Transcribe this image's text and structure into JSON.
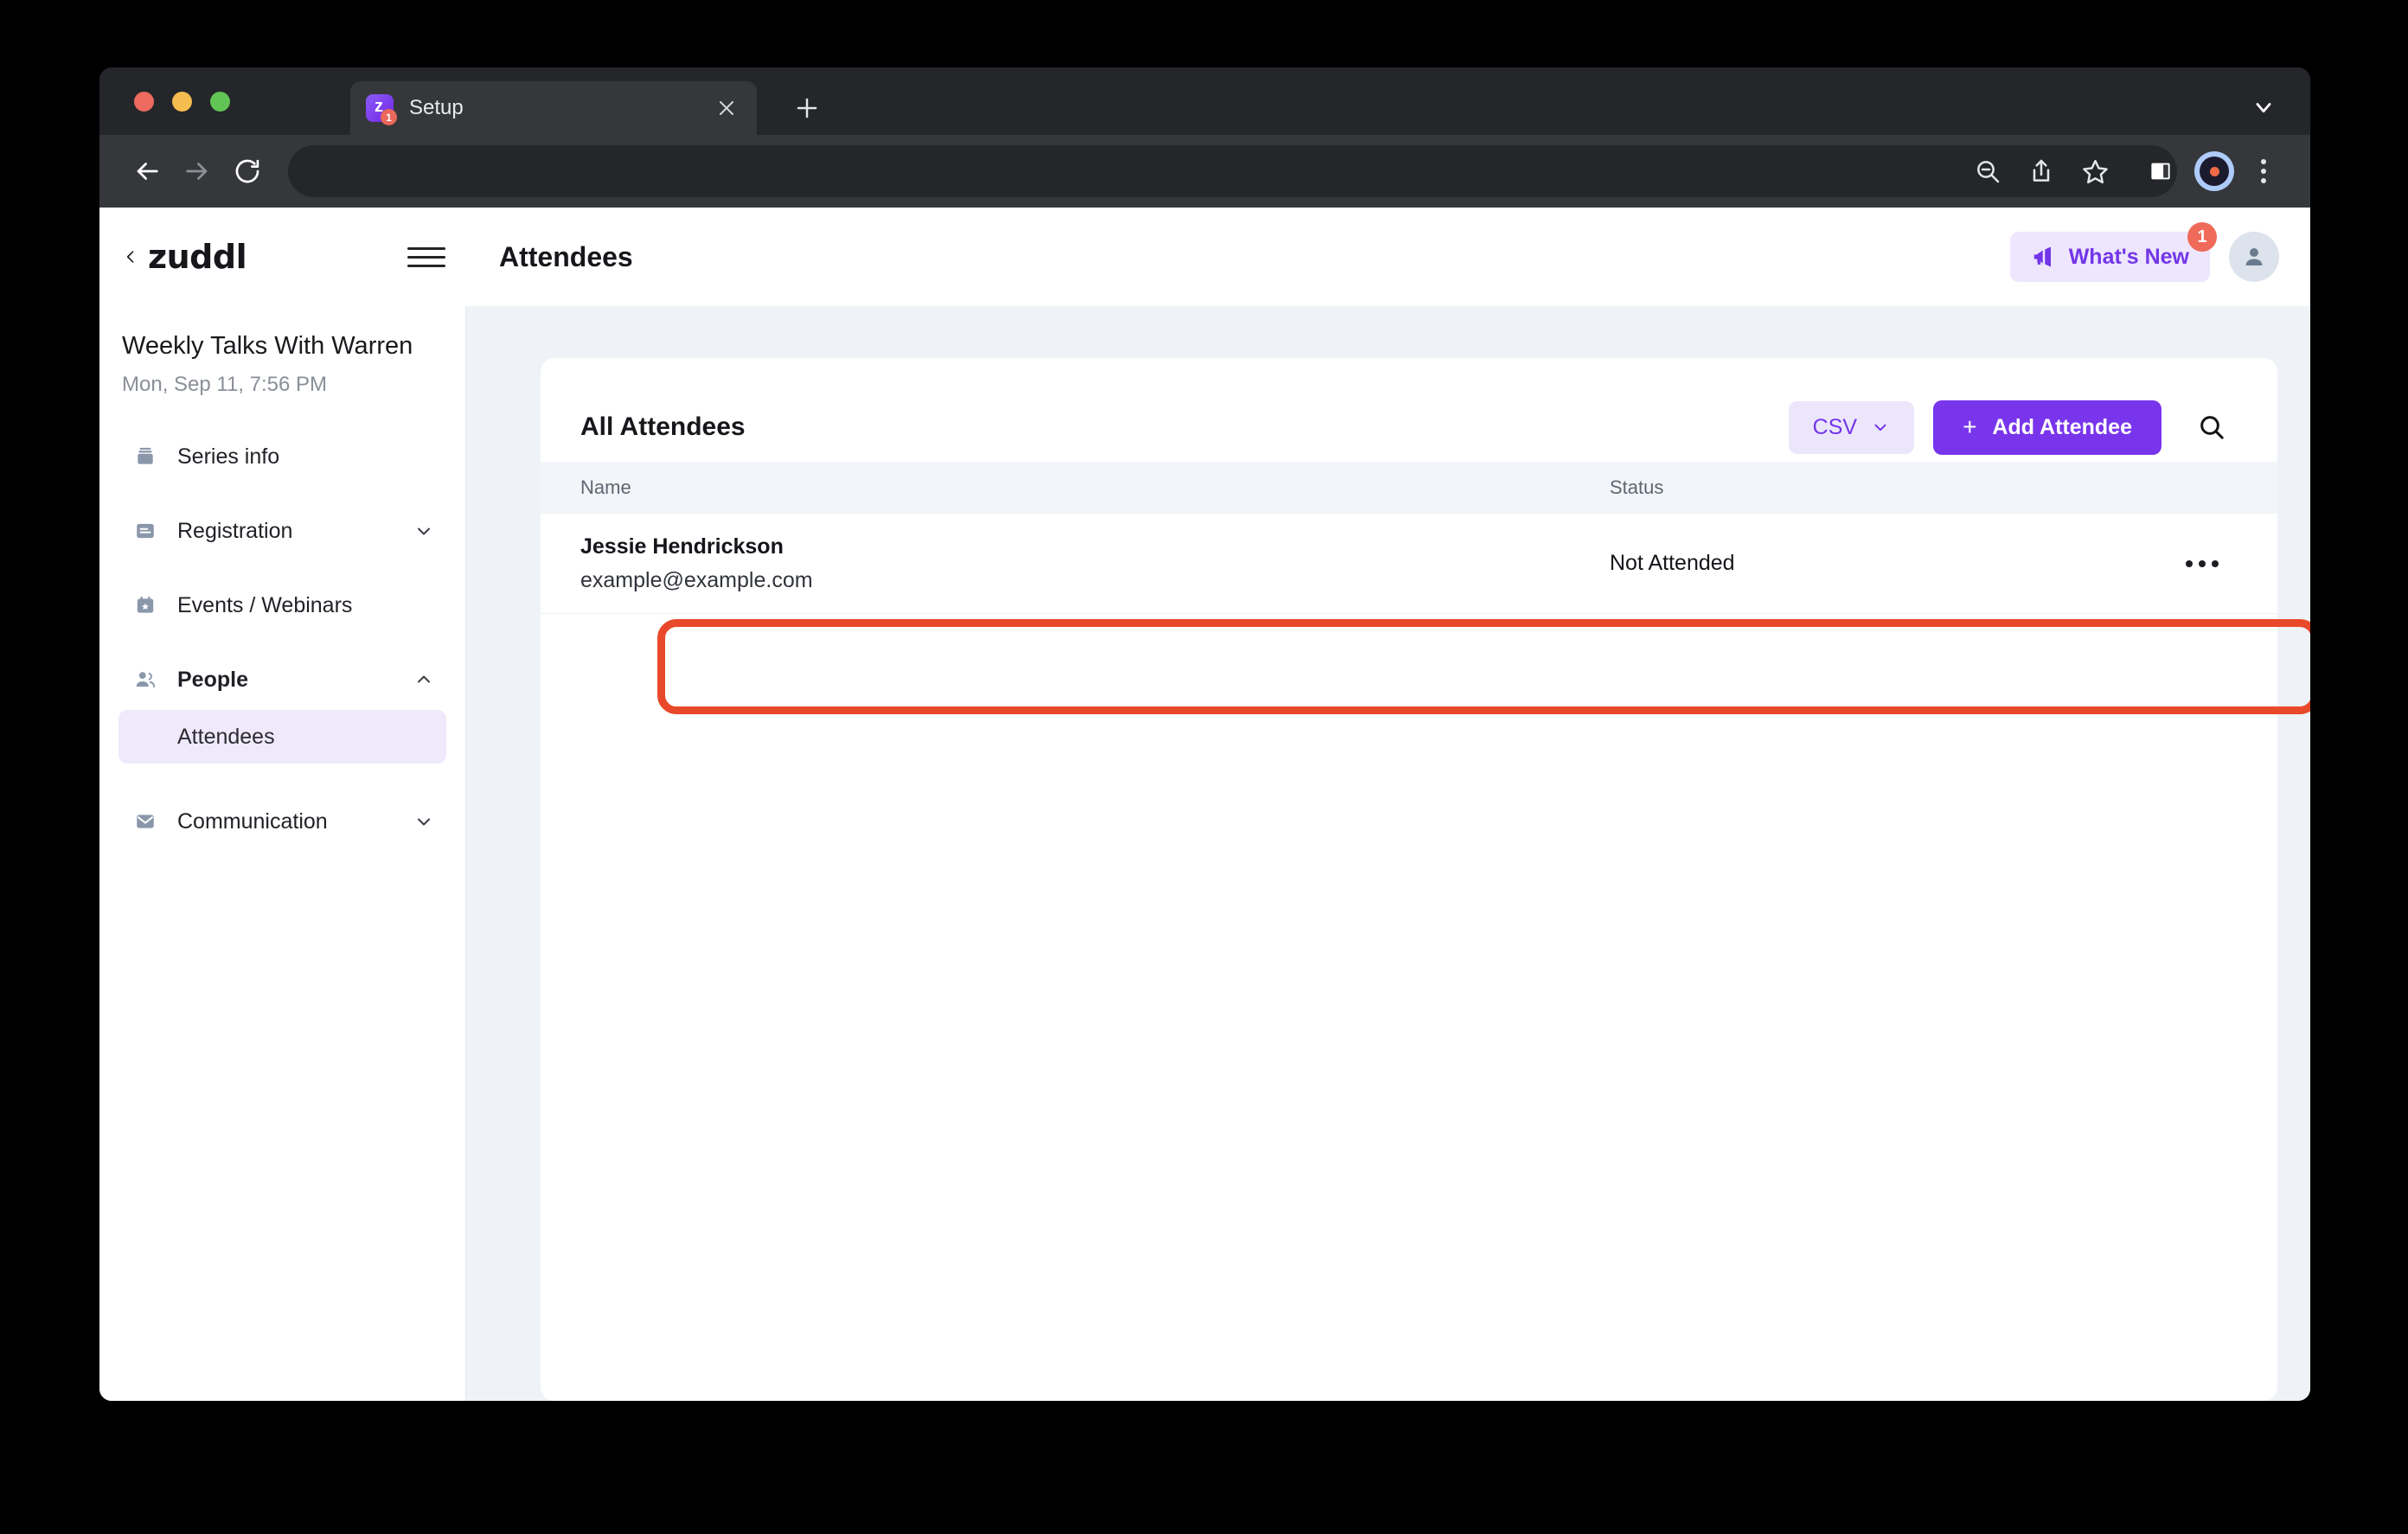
{
  "browser": {
    "tab": {
      "title": "Setup",
      "favicon_letter": "z",
      "favicon_badge": "1",
      "close_icon": "close-icon"
    },
    "new_tab_label": "+",
    "address_bar_value": "",
    "address_bar_placeholder": "",
    "toolbar_icons": [
      "back-icon",
      "forward-icon",
      "reload-icon",
      "zoom-out-icon",
      "share-icon",
      "bookmark-icon",
      "sidebar-icon",
      "profile-avatar-icon",
      "more-menu-icon"
    ],
    "tab_list_icon": "chevron-down-icon"
  },
  "header": {
    "brand": "zuddl",
    "back_icon": "chevron-left-icon",
    "menu_icon": "hamburger-icon",
    "page_title": "Attendees",
    "whats_new_label": "What's New",
    "whats_new_badge": "1",
    "whats_new_icon": "megaphone-icon",
    "avatar_icon": "person-icon"
  },
  "sidebar": {
    "series_title": "Weekly Talks With Warren",
    "series_date": "Mon, Sep 11, 7:56 PM",
    "items": [
      {
        "label": "Series info",
        "icon": "archive-icon",
        "chevron": "",
        "bold": false
      },
      {
        "label": "Registration",
        "icon": "form-icon",
        "chevron": "chevron-down-icon",
        "bold": false
      },
      {
        "label": "Events / Webinars",
        "icon": "calendar-star-icon",
        "chevron": "",
        "bold": false
      },
      {
        "label": "People",
        "icon": "people-icon",
        "chevron": "chevron-up-icon",
        "bold": true
      },
      {
        "label": "Communication",
        "icon": "envelope-icon",
        "chevron": "chevron-down-icon",
        "bold": false
      }
    ],
    "sub_items": [
      {
        "label": "Attendees",
        "active": true
      }
    ]
  },
  "main": {
    "card_title": "All Attendees",
    "csv_label": "CSV",
    "csv_chevron": "chevron-down-icon",
    "add_attendee_label": "Add Attendee",
    "add_attendee_plus": "+",
    "search_icon": "search-icon",
    "columns": [
      "Name",
      "Status"
    ],
    "rows": [
      {
        "name": "Jessie Hendrickson",
        "email": "example@example.com",
        "status": "Not Attended",
        "menu_icon": "more-horizontal-icon"
      }
    ]
  },
  "colors": {
    "accent_purple": "#7935ec",
    "accent_purple_soft": "#ece6fb",
    "badge_red": "#f06a5a",
    "annotation_orange": "#e8492a",
    "content_bg": "#eff2f7",
    "sidebar_active": "#efe9fb"
  }
}
